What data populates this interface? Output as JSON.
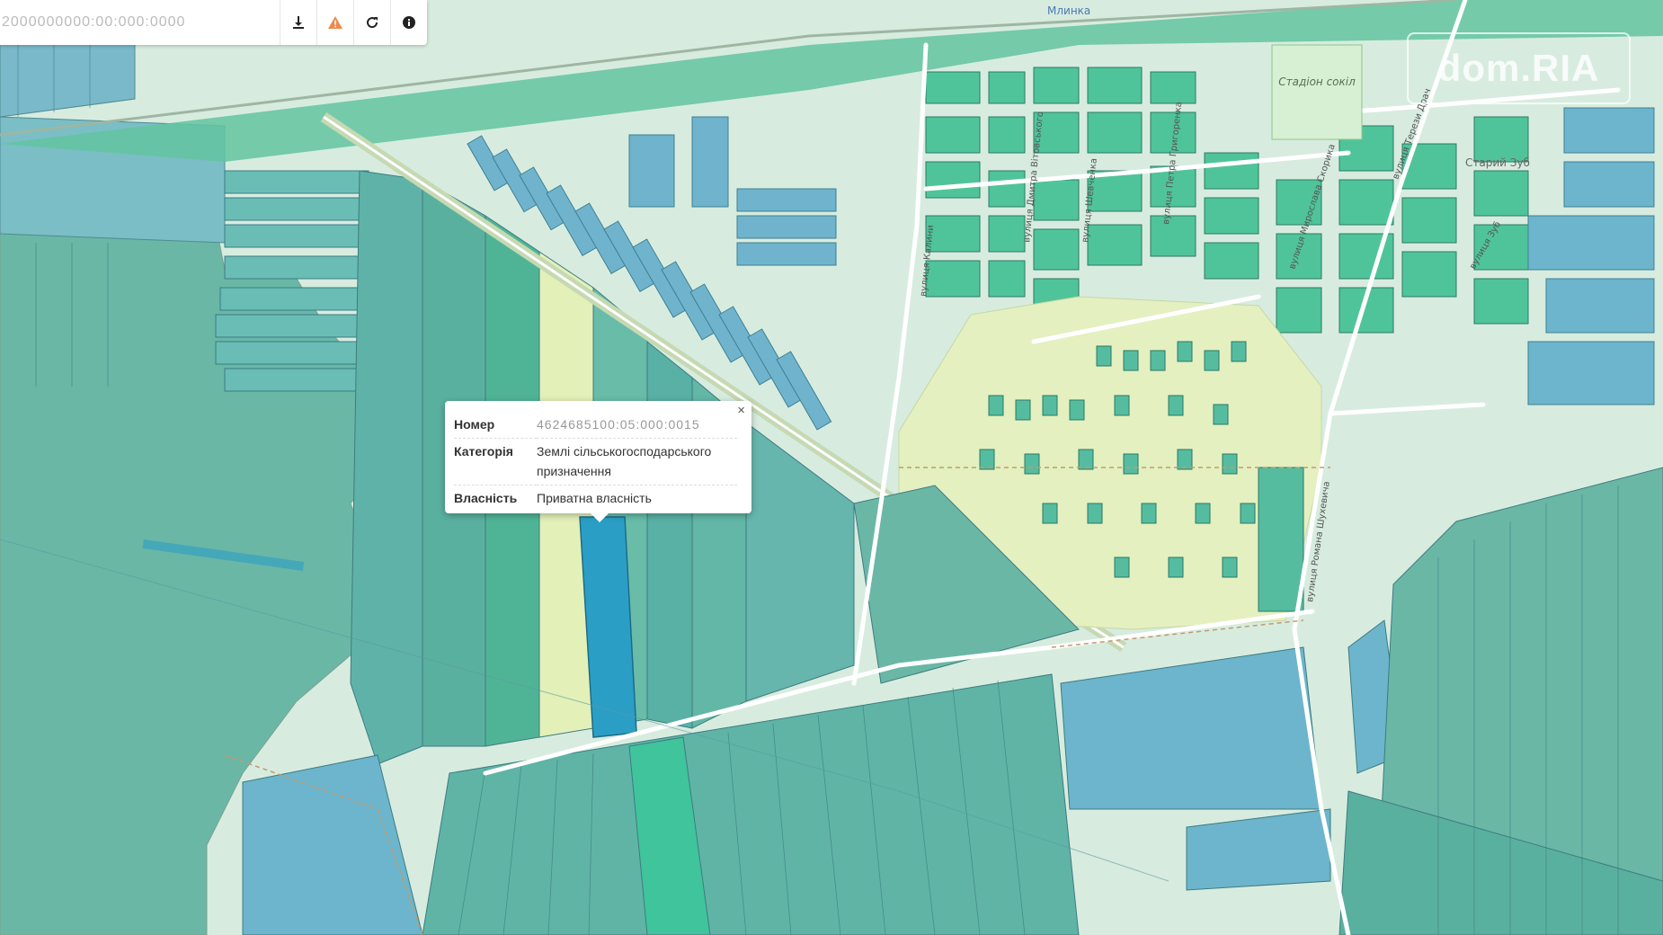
{
  "toolbar": {
    "cadastral_input": "2000000000:00:000:0000",
    "download_icon": "download-icon",
    "warning_icon": "warning-triangle-icon",
    "refresh_icon": "refresh-icon",
    "info_icon": "info-icon",
    "warning_color": "#ee8a4a"
  },
  "popup": {
    "close_label": "×",
    "rows": [
      {
        "key": "Номер",
        "value": "4624685100:05:000:0015"
      },
      {
        "key": "Категорія",
        "value": "Землі сільськогосподарського призначення"
      },
      {
        "key": "Власність",
        "value": "Приватна власність"
      }
    ]
  },
  "map_labels": {
    "stadium": "Стадіон сокіл",
    "river_top": "Млинка",
    "old_zub": "Старий Зуб",
    "street_kalyny": "вулиця Калини",
    "street_kukhar": "вулиця Дмитра Вітовського",
    "street_shevchenka": "вулиця Шевченка",
    "street_hryhorenka": "вулиця Петра Григоренка",
    "street_zub": "вулиця Зуб",
    "street_skoryka": "вулиця Мирослава Скорика",
    "street_roman": "вулиця Романа Шухевича",
    "street_lvivska": "вулиця Львівська",
    "street_terezy": "вулиця Терези Драч"
  },
  "watermark": "dom.RIA",
  "colors": {
    "parcel_teal": "#5fb5a4",
    "parcel_blue": "#6ab0c8",
    "parcel_green": "#3fc49b",
    "selected_parcel": "#2b9ec6",
    "land_light": "#e4f0c0",
    "road": "#ffffff"
  }
}
